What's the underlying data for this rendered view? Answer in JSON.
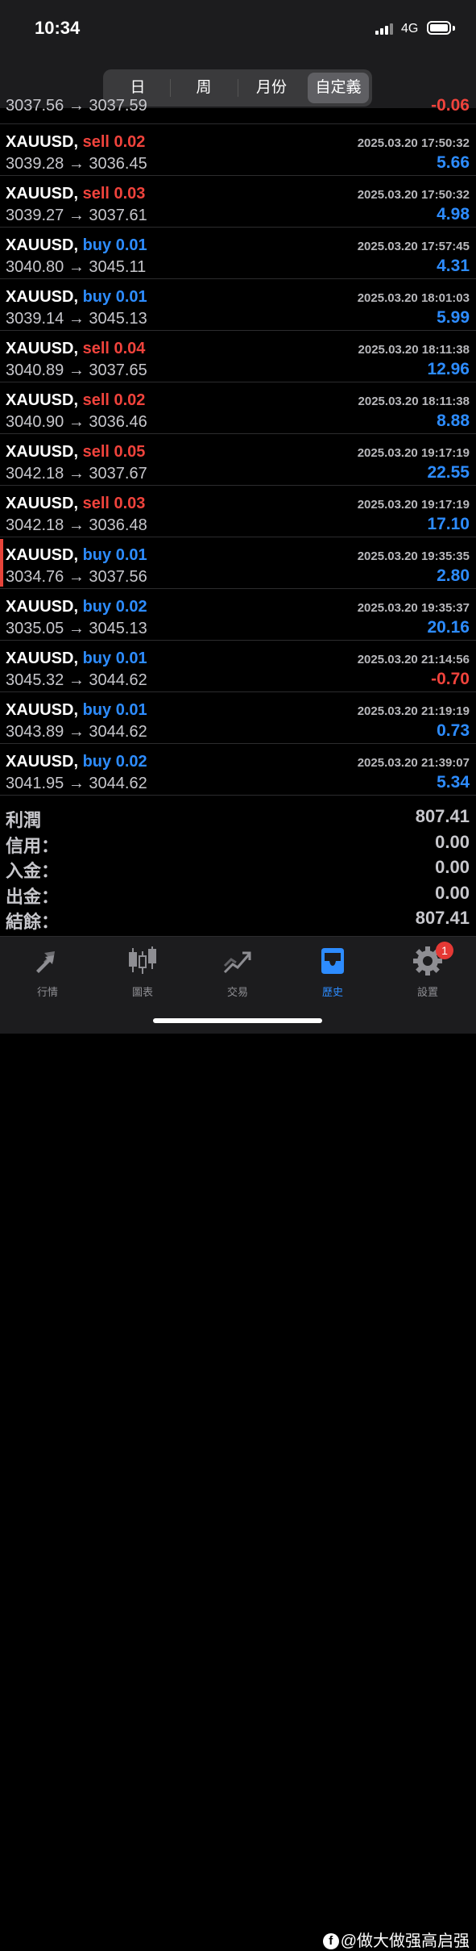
{
  "status": {
    "time": "10:34",
    "network": "4G"
  },
  "segments": [
    {
      "label": "日",
      "active": false
    },
    {
      "label": "周",
      "active": false
    },
    {
      "label": "月份",
      "active": false
    },
    {
      "label": "自定義",
      "active": true
    }
  ],
  "partial_row": {
    "price": "3037.56 → 3037.59",
    "profit": "-0.06"
  },
  "trades": [
    {
      "symbol": "XAUUSD,",
      "side": "sell",
      "volume": "0.02",
      "label": "sell 0.02",
      "date": "2025.03.20 17:50:32",
      "price": "3039.28 → 3036.45",
      "profit": "5.66"
    },
    {
      "symbol": "XAUUSD,",
      "side": "sell",
      "volume": "0.03",
      "label": "sell 0.03",
      "date": "2025.03.20 17:50:32",
      "price": "3039.27 → 3037.61",
      "profit": "4.98"
    },
    {
      "symbol": "XAUUSD,",
      "side": "buy",
      "volume": "0.01",
      "label": "buy 0.01",
      "date": "2025.03.20 17:57:45",
      "price": "3040.80 → 3045.11",
      "profit": "4.31"
    },
    {
      "symbol": "XAUUSD,",
      "side": "buy",
      "volume": "0.01",
      "label": "buy 0.01",
      "date": "2025.03.20 18:01:03",
      "price": "3039.14 → 3045.13",
      "profit": "5.99"
    },
    {
      "symbol": "XAUUSD,",
      "side": "sell",
      "volume": "0.04",
      "label": "sell 0.04",
      "date": "2025.03.20 18:11:38",
      "price": "3040.89 → 3037.65",
      "profit": "12.96"
    },
    {
      "symbol": "XAUUSD,",
      "side": "sell",
      "volume": "0.02",
      "label": "sell 0.02",
      "date": "2025.03.20 18:11:38",
      "price": "3040.90 → 3036.46",
      "profit": "8.88"
    },
    {
      "symbol": "XAUUSD,",
      "side": "sell",
      "volume": "0.05",
      "label": "sell 0.05",
      "date": "2025.03.20 19:17:19",
      "price": "3042.18 → 3037.67",
      "profit": "22.55"
    },
    {
      "symbol": "XAUUSD,",
      "side": "sell",
      "volume": "0.03",
      "label": "sell 0.03",
      "date": "2025.03.20 19:17:19",
      "price": "3042.18 → 3036.48",
      "profit": "17.10"
    },
    {
      "symbol": "XAUUSD,",
      "side": "buy",
      "volume": "0.01",
      "label": "buy 0.01",
      "date": "2025.03.20 19:35:35",
      "price": "3034.76 → 3037.56",
      "profit": "2.80",
      "marked": true
    },
    {
      "symbol": "XAUUSD,",
      "side": "buy",
      "volume": "0.02",
      "label": "buy 0.02",
      "date": "2025.03.20 19:35:37",
      "price": "3035.05 → 3045.13",
      "profit": "20.16"
    },
    {
      "symbol": "XAUUSD,",
      "side": "buy",
      "volume": "0.01",
      "label": "buy 0.01",
      "date": "2025.03.20 21:14:56",
      "price": "3045.32 → 3044.62",
      "profit": "-0.70"
    },
    {
      "symbol": "XAUUSD,",
      "side": "buy",
      "volume": "0.01",
      "label": "buy 0.01",
      "date": "2025.03.20 21:19:19",
      "price": "3043.89 → 3044.62",
      "profit": "0.73"
    },
    {
      "symbol": "XAUUSD,",
      "side": "buy",
      "volume": "0.02",
      "label": "buy 0.02",
      "date": "2025.03.20 21:39:07",
      "price": "3041.95 → 3044.62",
      "profit": "5.34"
    }
  ],
  "summary": [
    {
      "label": "利潤",
      "value": "807.41"
    },
    {
      "label": "信用：",
      "value": "0.00"
    },
    {
      "label": "入金：",
      "value": "0.00"
    },
    {
      "label": "出金：",
      "value": "0.00"
    },
    {
      "label": "結餘：",
      "value": "807.41"
    }
  ],
  "tabs": [
    {
      "label": "行情",
      "icon": "quotes-arrows-icon",
      "active": false
    },
    {
      "label": "圖表",
      "icon": "candlestick-chart-icon",
      "active": false
    },
    {
      "label": "交易",
      "icon": "trade-trend-icon",
      "active": false
    },
    {
      "label": "歷史",
      "icon": "history-inbox-icon",
      "active": true
    },
    {
      "label": "設置",
      "icon": "gear-icon",
      "active": false,
      "badge": "1"
    }
  ],
  "watermark": "@做大做强高启强",
  "colors": {
    "sell": "#f0433c",
    "buy": "#2d8cff",
    "accent": "#2d8cff",
    "badge": "#e53935"
  }
}
